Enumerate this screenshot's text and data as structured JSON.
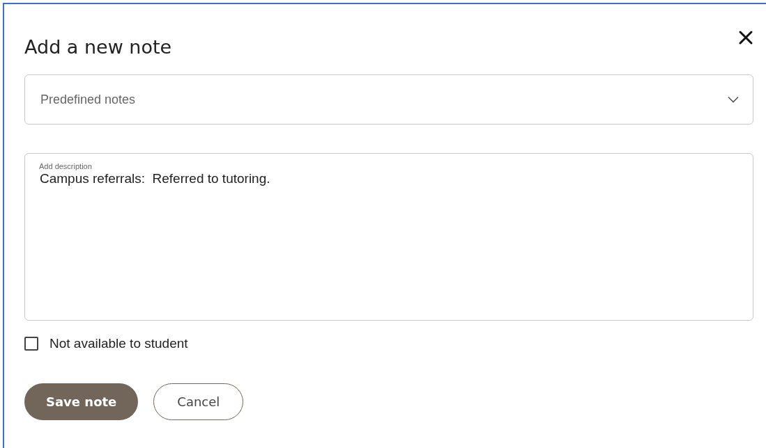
{
  "dialog": {
    "title": "Add a new note"
  },
  "predefined_notes": {
    "placeholder": "Predefined notes"
  },
  "description": {
    "label": "Add description",
    "value": "Campus referrals:  Referred to tutoring."
  },
  "options": [
    {
      "label": "Not available to student",
      "checked": false
    }
  ],
  "buttons": [
    {
      "label": "Save note",
      "kind": "primary"
    },
    {
      "label": "Cancel",
      "kind": "secondary"
    }
  ]
}
